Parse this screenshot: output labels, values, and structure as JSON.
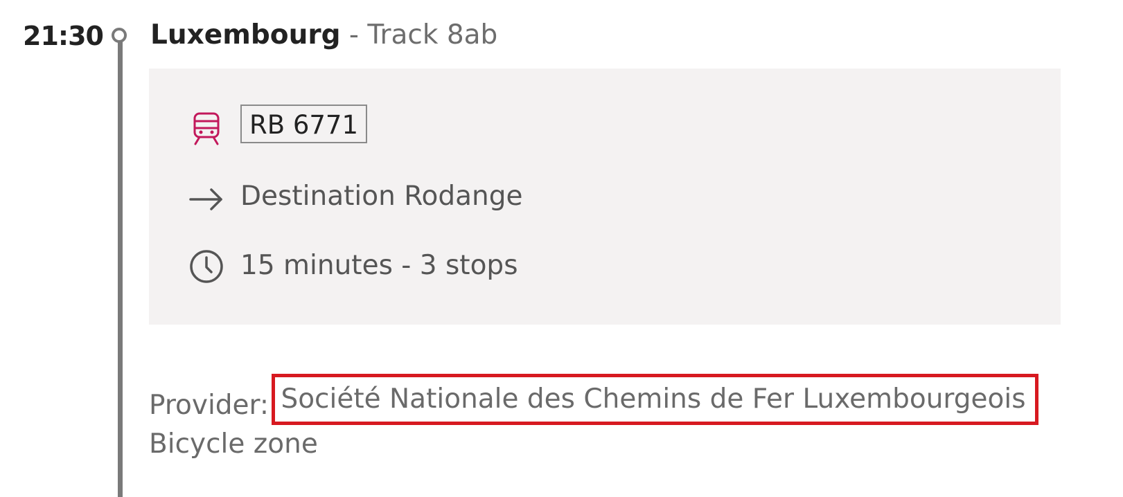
{
  "departure": {
    "time": "21:30",
    "station": "Luxembourg",
    "track": "- Track 8ab"
  },
  "leg": {
    "train": "RB 6771",
    "destination": "Destination Rodange",
    "duration_stops": "15 minutes - 3 stops"
  },
  "details": {
    "provider_label": "Provider:",
    "provider_name": "Société Nationale des Chemins de Fer Luxembourgeois",
    "feature": "Bicycle zone"
  },
  "icons": {
    "train": "train-icon",
    "destination": "arrow-right-icon",
    "duration": "clock-icon"
  },
  "colors": {
    "timeline": "#7a7a7a",
    "train_icon": "#c2185b",
    "card_background": "#f4f2f2",
    "highlight_box": "#d71920"
  }
}
